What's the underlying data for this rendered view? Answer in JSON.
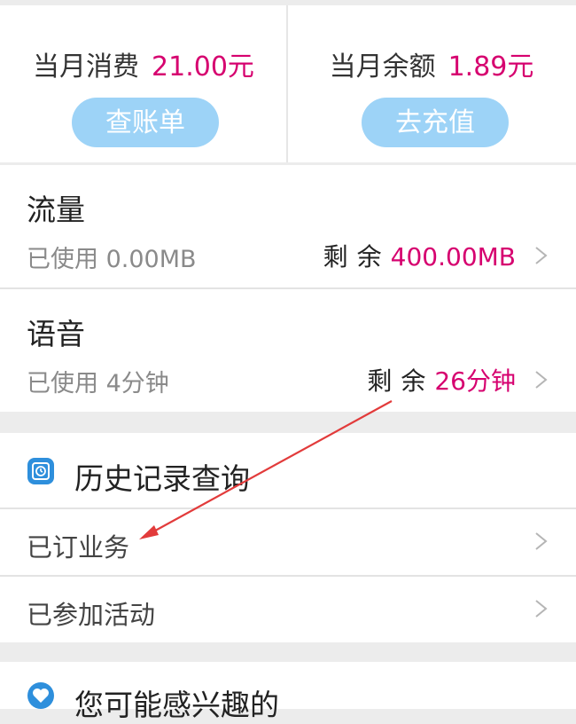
{
  "summary": {
    "monthly_spend": {
      "label": "当月消费",
      "value": "21.00元",
      "button": "查账单"
    },
    "balance": {
      "label": "当月余额",
      "value": "1.89元",
      "button": "去充值"
    }
  },
  "usage": [
    {
      "title": "流量",
      "used": "已使用 0.00MB",
      "remain_label": "剩余",
      "remain_value": "400.00MB"
    },
    {
      "title": "语音",
      "used": "已使用 4分钟",
      "remain_label": "剩余",
      "remain_value": "26分钟"
    }
  ],
  "history": {
    "title": "历史记录查询",
    "icon": "clock-icon",
    "items": [
      {
        "label": "已订业务"
      },
      {
        "label": "已参加活动"
      }
    ]
  },
  "interest": {
    "title": "您可能感兴趣的",
    "icon": "heart-icon"
  },
  "colors": {
    "accent": "#d6006f",
    "button": "#9dd3f7",
    "icon": "#2e8fdc",
    "annotation_arrow": "#e23b3b"
  }
}
